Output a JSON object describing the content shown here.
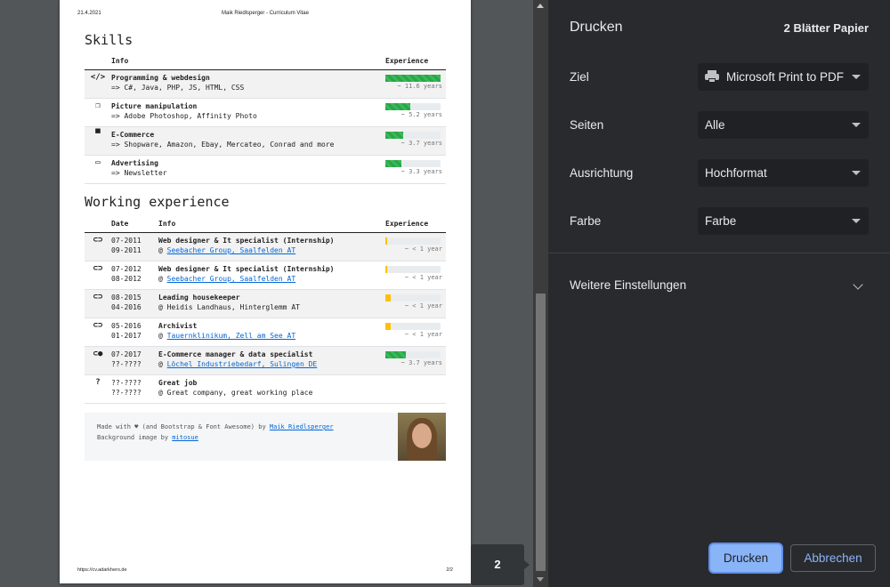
{
  "page": {
    "header_date": "21.4.2021",
    "header_title": "Maik Riedlsperger - Curriculum Vitae",
    "footer_url": "https://cv.adarkhero.de",
    "footer_page": "2/2"
  },
  "skills": {
    "title": "Skills",
    "col_info": "Info",
    "col_experience": "Experience",
    "rows": [
      {
        "icon": "code-icon",
        "glyph": "</>",
        "title": "Programming & webdesign",
        "detail": "=> C#, Java, PHP, JS, HTML, CSS",
        "years": 11.6,
        "label": "~ 11.6 years"
      },
      {
        "icon": "images-icon",
        "glyph": "❐",
        "title": "Picture manipulation",
        "detail": "=> Adobe Photoshop, Affinity Photo",
        "years": 5.2,
        "label": "~ 5.2 years"
      },
      {
        "icon": "store-icon",
        "glyph": "▀",
        "title": "E-Commerce",
        "detail": "=> Shopware, Amazon, Ebay, Mercateo, Conrad and more",
        "years": 3.7,
        "label": "~ 3.7 years"
      },
      {
        "icon": "ad-icon",
        "glyph": "▭",
        "title": "Advertising",
        "detail": "=> Newsletter",
        "years": 3.3,
        "label": "~ 3.3 years"
      }
    ]
  },
  "work": {
    "title": "Working experience",
    "col_date": "Date",
    "col_info": "Info",
    "col_experience": "Experience",
    "rows": [
      {
        "icon": "toggle-off-icon",
        "glyph": "⊂⊃",
        "start": "07-2011",
        "end": "09-2011",
        "title": "Web designer & It specialist (Internship)",
        "at": "@ ",
        "place": "Seebacher Group, Saalfelden AT",
        "link": true,
        "label": "~ < 1 year",
        "fraction": 0.04,
        "color": "yellow"
      },
      {
        "icon": "toggle-off-icon",
        "glyph": "⊂⊃",
        "start": "07-2012",
        "end": "08-2012",
        "title": "Web designer & It specialist (Internship)",
        "at": "@ ",
        "place": "Seebacher Group, Saalfelden AT",
        "link": true,
        "label": "~ < 1 year",
        "fraction": 0.04,
        "color": "yellow"
      },
      {
        "icon": "toggle-off-icon",
        "glyph": "⊂⊃",
        "start": "08-2015",
        "end": "04-2016",
        "title": "Leading housekeeper",
        "at": "@ ",
        "place": "Heidis Landhaus, Hinterglemm AT",
        "link": false,
        "label": "~ < 1 year",
        "fraction": 0.1,
        "color": "yellow"
      },
      {
        "icon": "toggle-off-icon",
        "glyph": "⊂⊃",
        "start": "05-2016",
        "end": "01-2017",
        "title": "Archivist",
        "at": "@ ",
        "place": "Tauernklinikum, Zell am See AT",
        "link": true,
        "label": "~ < 1 year",
        "fraction": 0.1,
        "color": "yellow"
      },
      {
        "icon": "toggle-on-icon",
        "glyph": "⊂●",
        "start": "07-2017",
        "end": "??-????",
        "title": "E-Commerce manager & data specialist",
        "at": "@ ",
        "place": "Löchel Industriebedarf, Sulingen DE",
        "link": true,
        "label": "~ 3.7 years",
        "fraction": 0.37,
        "color": "green"
      },
      {
        "icon": "question-circle-icon",
        "glyph": "?",
        "start": "??-????",
        "end": "??-????",
        "title": "Great job",
        "at": "@ ",
        "place": "Great company, great working place",
        "link": false,
        "label": "",
        "fraction": 0,
        "color": "none"
      }
    ]
  },
  "credits": {
    "line1_pre": "Made with ",
    "heart": "♥",
    "line1_mid": " (and Bootstrap & Font Awesome) by ",
    "author": "Maik Riedlsperger",
    "line2_pre": "Background image by ",
    "bg_author": "mitosue"
  },
  "preview": {
    "page_badge": "2"
  },
  "panel": {
    "title": "Drucken",
    "sheet_count": "2 Blätter Papier",
    "destination_label": "Ziel",
    "destination_value": "Microsoft Print to PDF",
    "pages_label": "Seiten",
    "pages_value": "Alle",
    "orientation_label": "Ausrichtung",
    "orientation_value": "Hochformat",
    "color_label": "Farbe",
    "color_value": "Farbe",
    "more_settings": "Weitere Einstellungen",
    "print_button": "Drucken",
    "cancel_button": "Abbrechen"
  },
  "colors": {
    "accent": "#8ab4f8",
    "panel_bg": "#292a2d",
    "bar_green": "#28a745",
    "bar_yellow": "#ffc107",
    "link": "#0366d6"
  }
}
